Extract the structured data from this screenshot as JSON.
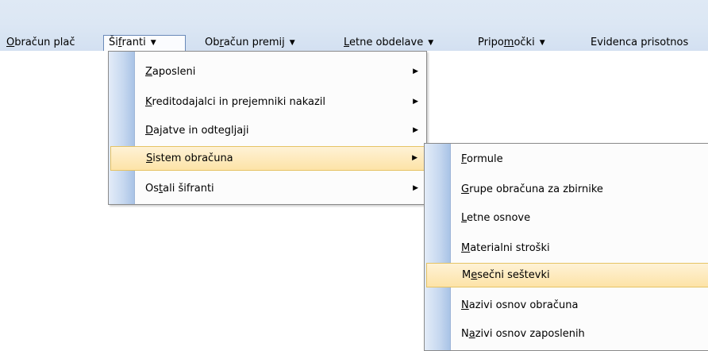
{
  "menubar": {
    "items": [
      {
        "pre": "",
        "acc": "O",
        "post": "bračun plač",
        "arrow": false
      },
      {
        "pre": "Ši",
        "acc": "f",
        "post": "ranti",
        "arrow": true
      },
      {
        "pre": "Ob",
        "acc": "r",
        "post": "ačun premij",
        "arrow": true
      },
      {
        "pre": "",
        "acc": "L",
        "post": "etne obdelave",
        "arrow": true
      },
      {
        "pre": "Pripo",
        "acc": "m",
        "post": "očki",
        "arrow": true
      },
      {
        "pre": "Evidenca prisotnos",
        "acc": "",
        "post": "",
        "arrow": false
      }
    ]
  },
  "sifranti_menu": {
    "items": [
      {
        "pre": "",
        "acc": "Z",
        "post": "aposleni",
        "submenu": true
      },
      {
        "pre": "",
        "acc": "K",
        "post": "reditodajalci in prejemniki nakazil",
        "submenu": true
      },
      {
        "pre": "",
        "acc": "D",
        "post": "ajatve in odtegljaji",
        "submenu": true
      },
      {
        "pre": "",
        "acc": "S",
        "post": "istem obračuna",
        "submenu": true
      },
      {
        "pre": "Os",
        "acc": "t",
        "post": "ali šifranti",
        "submenu": true
      }
    ]
  },
  "sistem_obracuna_menu": {
    "items": [
      {
        "pre": "",
        "acc": "F",
        "post": "ormule"
      },
      {
        "pre": "",
        "acc": "G",
        "post": "rupe obračuna za zbirnike"
      },
      {
        "pre": "",
        "acc": "L",
        "post": "etne osnove"
      },
      {
        "pre": "",
        "acc": "M",
        "post": "aterialni stroški"
      },
      {
        "pre": "M",
        "acc": "e",
        "post": "sečni seštevki"
      },
      {
        "pre": "",
        "acc": "N",
        "post": "azivi osnov obračuna"
      },
      {
        "pre": "N",
        "acc": "a",
        "post": "zivi osnov zaposlenih"
      }
    ]
  },
  "glyphs": {
    "down_arrow": "▼",
    "right_arrow": "▶"
  }
}
